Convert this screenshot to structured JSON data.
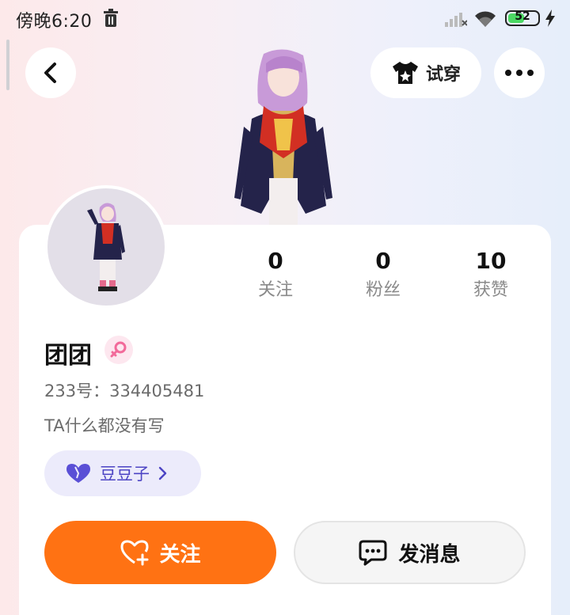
{
  "status_bar": {
    "time": "傍晚6:20",
    "battery": "52"
  },
  "header": {
    "tryon_label": "试穿"
  },
  "profile": {
    "username": "团团",
    "account_id": "233号：334405481",
    "bio": "TA什么都没有写",
    "currency_label": "豆豆子",
    "stats": [
      {
        "value": "0",
        "label": "关注"
      },
      {
        "value": "0",
        "label": "粉丝"
      },
      {
        "value": "10",
        "label": "获赞"
      }
    ]
  },
  "actions": {
    "follow_label": "关注",
    "message_label": "发消息"
  },
  "colors": {
    "accent_orange": "#ff7213",
    "chip_purple": "#4d45c4",
    "gender_pink": "#f26a9a"
  },
  "icons": {
    "back": "chevron-left-icon",
    "tryon": "tshirt-icon",
    "more": "more-dots-icon",
    "gender": "female-icon",
    "currency": "heart-icon",
    "follow": "heart-plus-icon",
    "message": "chat-bubble-icon"
  }
}
